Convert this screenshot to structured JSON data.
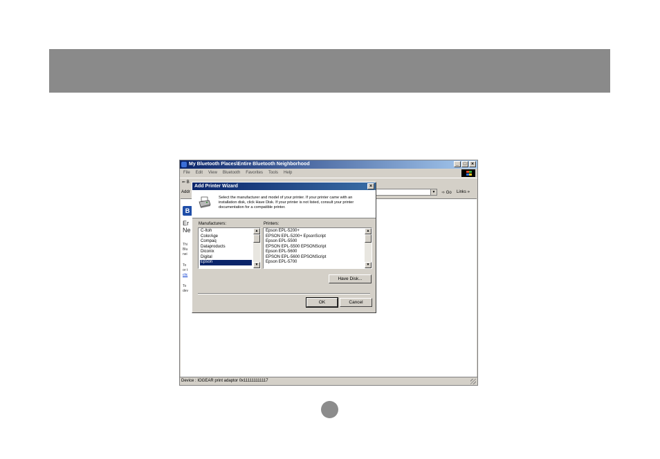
{
  "explorer": {
    "title": "My Bluetooth Places\\Entire Bluetooth Neighborhood",
    "menu": [
      "File",
      "Edit",
      "View",
      "Bluetooth",
      "Favorites",
      "Tools",
      "Help"
    ],
    "toolbar_back": "⇐ B",
    "address_label": "Addr",
    "go_label": "Go",
    "links_label": "Links »",
    "side_heading_1": "Er",
    "side_heading_2": "Ne",
    "side_text_1": "Thi",
    "side_text_2": "Blu",
    "side_text_3": "nei",
    "side_text_4": "To",
    "side_text_5": "or t",
    "side_text_6": "clic",
    "side_text_7": "To",
    "side_text_8": "dev",
    "status": "Device : IOGEAR print adaptor 0x111111111117"
  },
  "dialog": {
    "title": "Add Printer Wizard",
    "instruction": "Select the manufacturer and model of your printer. If your printer came with an installation disk, click Have Disk. If your printer is not listed, consult your printer documentation for a compatible printer.",
    "manufacturers_label": "Manufacturers:",
    "printers_label": "Printers:",
    "manufacturers": [
      "C-Itoh",
      "ColorAge",
      "Compaq",
      "Dataproducts",
      "Diconix",
      "Digital",
      "Epson"
    ],
    "selected_manufacturer": "Epson",
    "printers": [
      "Epson EPL-5200+",
      "EPSON EPL-5200+ EpsonScript",
      "Epson EPL-5500",
      "EPSON EPL-5500 EPSONScript",
      "Epson EPL-5600",
      "EPSON EPL-5600 EPSONScript",
      "Epson EPL-5700"
    ],
    "have_disk_label": "Have Disk...",
    "ok_label": "OK",
    "cancel_label": "Cancel"
  }
}
